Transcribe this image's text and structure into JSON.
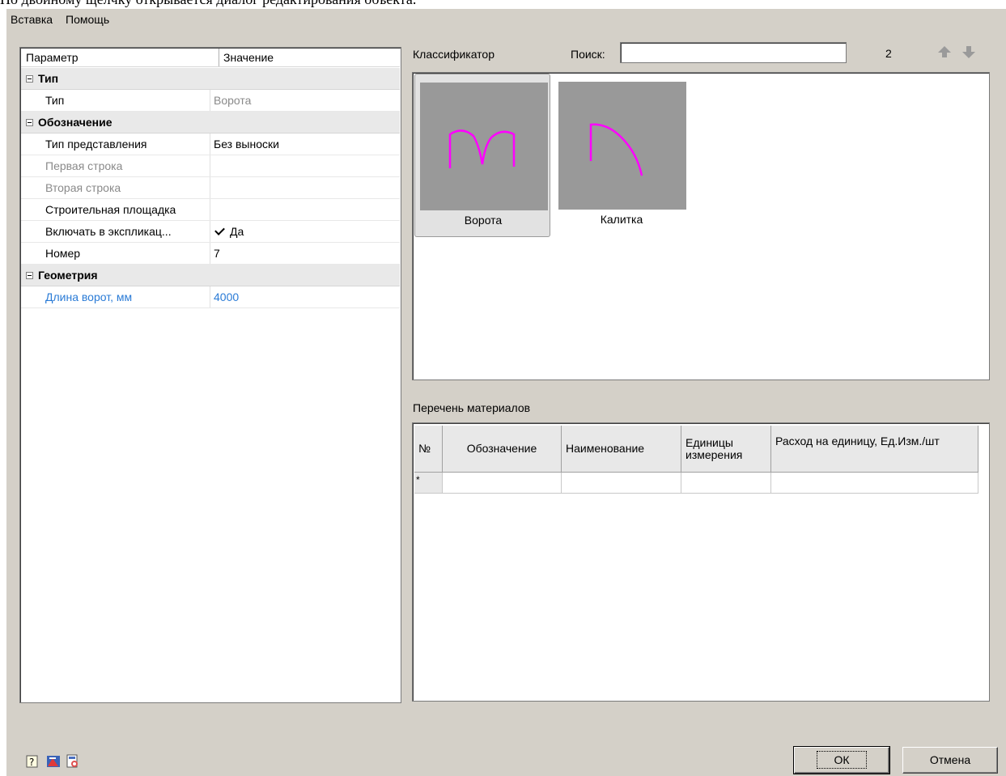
{
  "caption": "По двойному щелчку открывается диалог редактирования объекта.",
  "menu": [
    "Вставка",
    "Помощь"
  ],
  "propgrid": {
    "col_param": "Параметр",
    "col_value": "Значение",
    "cat_type": "Тип",
    "type_name": "Тип",
    "type_value": "Ворота",
    "cat_designation": "Обозначение",
    "repr_name": "Тип представления",
    "repr_value": "Без выноски",
    "line1_name": "Первая строка",
    "line2_name": "Вторая строка",
    "site_name": "Строительная площадка",
    "incl_name": "Включать в экспликац...",
    "incl_value": "Да",
    "num_name": "Номер",
    "num_value": "7",
    "cat_geometry": "Геометрия",
    "length_name": "Длина ворот, мм",
    "length_value": "4000"
  },
  "classifier": {
    "label": "Классификатор",
    "search_label": "Поиск:",
    "search_value": "",
    "count": "2",
    "items": [
      "Ворота",
      "Калитка"
    ],
    "line_color": "#ff00ff"
  },
  "materials": {
    "label": "Перечень материалов",
    "headers": [
      "№",
      "Обозначение",
      "Наименование",
      "Единицы измерения",
      "Расход на единицу, Ед.Изм./шт"
    ],
    "new_row_marker": "*"
  },
  "buttons": {
    "ok": "ОК",
    "cancel": "Отмена"
  }
}
